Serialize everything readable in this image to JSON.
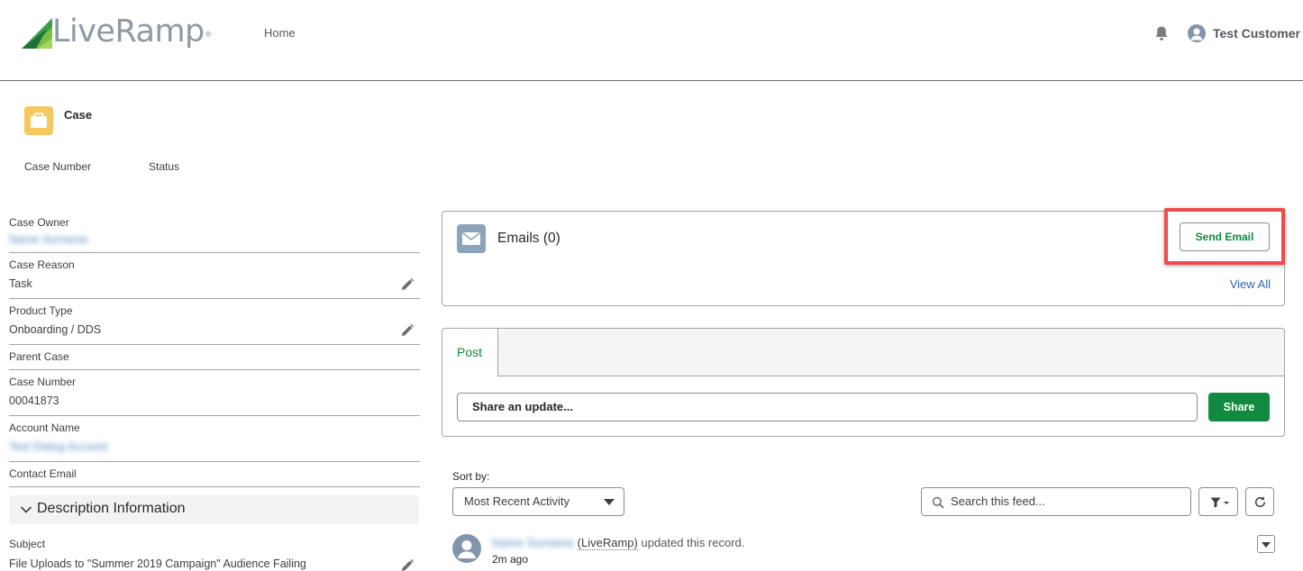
{
  "header": {
    "logo_text": "LiveRamp",
    "logo_mark": "®",
    "nav_home": "Home",
    "user_name": "Test Customer",
    "icons": {
      "notifications": "bell-icon",
      "user": "user-avatar-icon"
    }
  },
  "record": {
    "object_label": "Case",
    "highlights": [
      "Case Number",
      "Status"
    ]
  },
  "details": {
    "case_owner": {
      "label": "Case Owner",
      "value": "Name Surname"
    },
    "case_reason": {
      "label": "Case Reason",
      "value": "Task"
    },
    "product_type": {
      "label": "Product Type",
      "value": "Onboarding / DDS"
    },
    "parent_case": {
      "label": "Parent Case"
    },
    "case_number": {
      "label": "Case Number",
      "value": "00041873"
    },
    "account_name": {
      "label": "Account Name",
      "value": "Test Dialog Account"
    },
    "contact_email": {
      "label": "Contact Email"
    },
    "description_section": "Description Information",
    "subject": {
      "label": "Subject",
      "value": "File Uploads to \"Summer 2019 Campaign\" Audience Failing"
    }
  },
  "emails": {
    "title": "Emails (0)",
    "send_button": "Send Email",
    "view_all": "View All"
  },
  "publisher": {
    "tab_post": "Post",
    "input_placeholder": "Share an update...",
    "share_button": "Share"
  },
  "feed": {
    "sort_label": "Sort by:",
    "sort_value": "Most Recent Activity",
    "search_placeholder": "Search this feed...",
    "item": {
      "actor": "Name Surname",
      "org": "(LiveRamp)",
      "action": "updated this record.",
      "time": "2m ago"
    }
  },
  "colors": {
    "brand_green": "#0f8a3e",
    "link_blue": "#2a66b7",
    "highlight_red": "#ef4b4b",
    "case_icon": "#f4c85e",
    "email_icon": "#8ca3b9"
  }
}
